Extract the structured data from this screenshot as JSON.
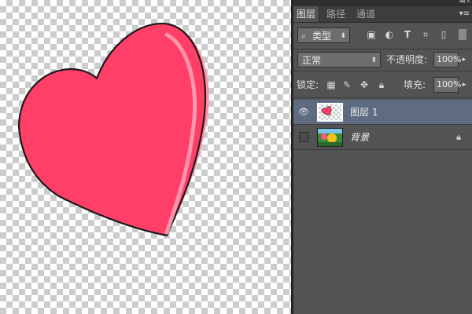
{
  "panel": {
    "tabs": [
      {
        "label": "图层",
        "active": true
      },
      {
        "label": "路径",
        "active": false
      },
      {
        "label": "通道",
        "active": false
      }
    ],
    "filter_kind": {
      "value": "类型"
    },
    "filter_icons": [
      "image-filter-icon",
      "adjustment-filter-icon",
      "type-filter-icon",
      "shape-filter-icon",
      "smart-object-filter-icon"
    ],
    "blend_mode": {
      "value": "正常"
    },
    "opacity": {
      "label": "不透明度:",
      "value": "100%"
    },
    "lock": {
      "label": "锁定:",
      "icons": [
        "lock-transparent-pixels-icon",
        "lock-image-pixels-icon",
        "lock-position-icon",
        "lock-all-icon"
      ]
    },
    "fill": {
      "label": "填充:",
      "value": "100%"
    }
  },
  "layers": [
    {
      "name": "图层 1",
      "visible": true,
      "selected": true,
      "thumbnail": "heart-thumbnail",
      "locked": false
    },
    {
      "name": "背景",
      "visible": false,
      "selected": false,
      "thumbnail": "background-thumbnail",
      "locked": true
    }
  ],
  "canvas": {
    "transparent": true,
    "shape": "heart",
    "heart_color": "#ff3f68",
    "heart_highlight": "#ff8ea4",
    "outline_color": "#1a1a1a"
  },
  "colors": {
    "panel_bg": "#535353",
    "tab_bar": "#3d3d3d",
    "selected_row": "#5e6b80",
    "field_bg": "#6e6e6e"
  }
}
